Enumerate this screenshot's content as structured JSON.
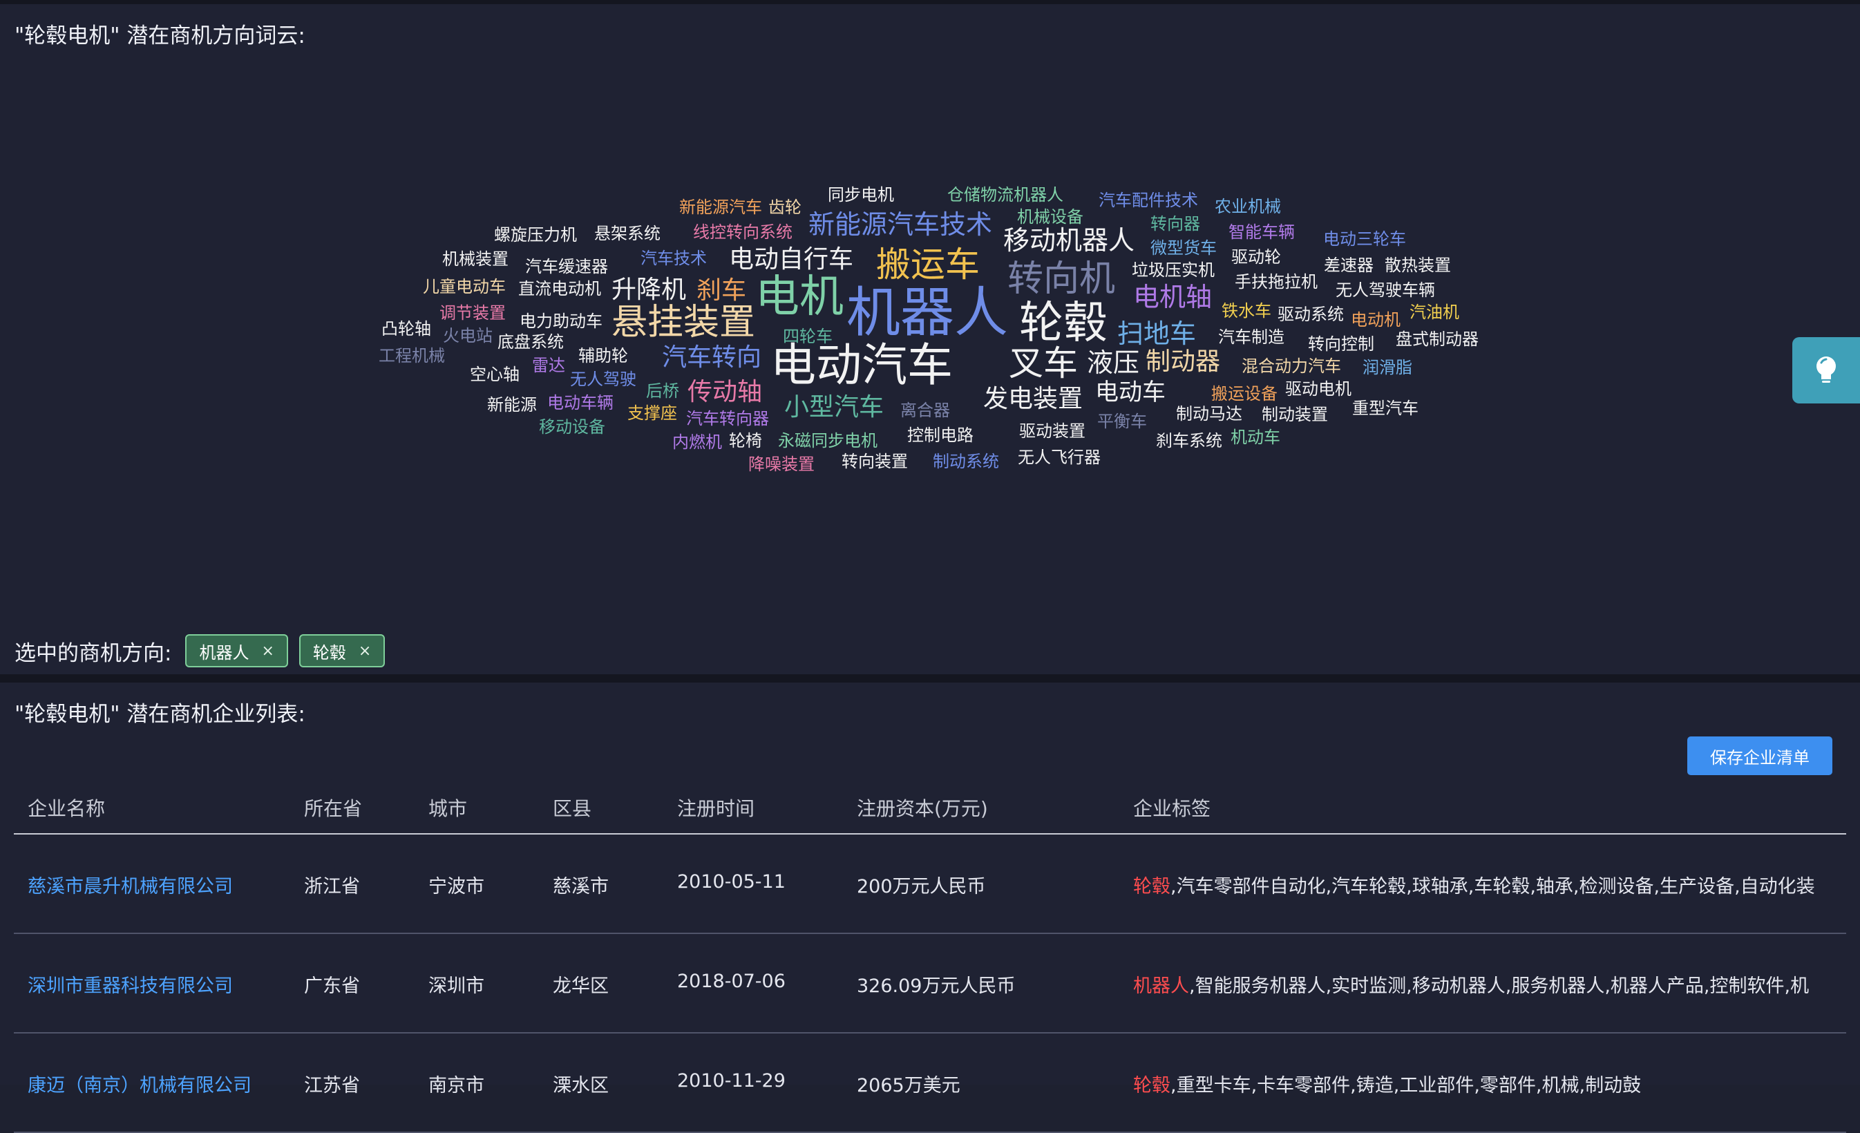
{
  "wordcloud_section": {
    "title": "\"轮毂电机\" 潜在商机方向词云:",
    "selected_label": "选中的商机方向:",
    "selected_tags": [
      "机器人",
      "轮毂"
    ],
    "tag_close": "×"
  },
  "colors": {
    "background": "#1f2233",
    "link": "#4da3ff",
    "highlight": "#ff4d4f",
    "tag_bg": "#356a4f",
    "button": "#3d8ff0"
  },
  "words": [
    {
      "t": "机器人",
      "c": "#6f8de8"
    },
    {
      "t": "电机",
      "c": "#7fd1a8"
    },
    {
      "t": "电动汽车",
      "c": "#f2f2f2"
    },
    {
      "t": "轮毂",
      "c": "#f2f2f2"
    },
    {
      "t": "悬挂装置",
      "c": "#f2d7a8"
    },
    {
      "t": "搬运车",
      "c": "#f2c24f"
    },
    {
      "t": "转向机",
      "c": "#7a82a8"
    },
    {
      "t": "叉车",
      "c": "#f2f2f2"
    },
    {
      "t": "移动机器人",
      "c": "#f2f2f2"
    },
    {
      "t": "新能源汽车技术",
      "c": "#6f8de8"
    },
    {
      "t": "电动自行车",
      "c": "#f2f2f2"
    },
    {
      "t": "升降机",
      "c": "#f2f2f2"
    },
    {
      "t": "刹车",
      "c": "#f2a25a"
    },
    {
      "t": "汽车转向",
      "c": "#6f8de8"
    },
    {
      "t": "传动轴",
      "c": "#e87aa8"
    },
    {
      "t": "小型汽车",
      "c": "#5fb8a0"
    },
    {
      "t": "液压",
      "c": "#f2f2f2"
    },
    {
      "t": "制动器",
      "c": "#f2d7a8"
    },
    {
      "t": "发电装置",
      "c": "#f2f2f2"
    },
    {
      "t": "电动车",
      "c": "#f2f2f2"
    },
    {
      "t": "电机轴",
      "c": "#b07ae8"
    },
    {
      "t": "扫地车",
      "c": "#6fb0e8"
    },
    {
      "t": "新能源汽车",
      "c": "#f2a25a"
    },
    {
      "t": "齿轮",
      "c": "#f2d7a8"
    },
    {
      "t": "同步电机",
      "c": "#f2f2f2"
    },
    {
      "t": "仓储物流机器人",
      "c": "#7fd1a8"
    },
    {
      "t": "汽车配件技术",
      "c": "#6f8de8"
    },
    {
      "t": "农业机械",
      "c": "#6fb0e8"
    },
    {
      "t": "螺旋压力机",
      "c": "#f2f2f2"
    },
    {
      "t": "悬架系统",
      "c": "#f2f2f2"
    },
    {
      "t": "线控转向系统",
      "c": "#e87aa8"
    },
    {
      "t": "机械设备",
      "c": "#7fd1a8"
    },
    {
      "t": "转向器",
      "c": "#5fb8a0"
    },
    {
      "t": "智能车辆",
      "c": "#b07ae8"
    },
    {
      "t": "电动三轮车",
      "c": "#6f8de8"
    },
    {
      "t": "机械装置",
      "c": "#f2f2f2"
    },
    {
      "t": "汽车缓速器",
      "c": "#f2f2f2"
    },
    {
      "t": "汽车技术",
      "c": "#6f8de8"
    },
    {
      "t": "微型货车",
      "c": "#6fb0e8"
    },
    {
      "t": "驱动轮",
      "c": "#f2f2f2"
    },
    {
      "t": "差速器",
      "c": "#f2f2f2"
    },
    {
      "t": "散热装置",
      "c": "#f2f2f2"
    },
    {
      "t": "儿童电动车",
      "c": "#f2d7a8"
    },
    {
      "t": "直流电动机",
      "c": "#f2f2f2"
    },
    {
      "t": "垃圾压实机",
      "c": "#f2f2f2"
    },
    {
      "t": "手扶拖拉机",
      "c": "#f2f2f2"
    },
    {
      "t": "无人驾驶车辆",
      "c": "#f2f2f2"
    },
    {
      "t": "调节装置",
      "c": "#e87aa8"
    },
    {
      "t": "电力助动车",
      "c": "#f2f2f2"
    },
    {
      "t": "铁水车",
      "c": "#f2d04f"
    },
    {
      "t": "驱动系统",
      "c": "#f2f2f2"
    },
    {
      "t": "电动机",
      "c": "#f2a25a"
    },
    {
      "t": "汽油机",
      "c": "#f2d04f"
    },
    {
      "t": "凸轮轴",
      "c": "#f2f2f2"
    },
    {
      "t": "火电站",
      "c": "#7a82a8"
    },
    {
      "t": "底盘系统",
      "c": "#f2f2f2"
    },
    {
      "t": "四轮车",
      "c": "#5fb8a0"
    },
    {
      "t": "汽车制造",
      "c": "#f2f2f2"
    },
    {
      "t": "转向控制",
      "c": "#f2f2f2"
    },
    {
      "t": "盘式制动器",
      "c": "#f2f2f2"
    },
    {
      "t": "工程机械",
      "c": "#7a82a8"
    },
    {
      "t": "辅助轮",
      "c": "#f2f2f2"
    },
    {
      "t": "雷达",
      "c": "#b07ae8"
    },
    {
      "t": "混合动力汽车",
      "c": "#f2d7a8"
    },
    {
      "t": "润滑脂",
      "c": "#6fb0e8"
    },
    {
      "t": "空心轴",
      "c": "#f2f2f2"
    },
    {
      "t": "无人驾驶",
      "c": "#6f8de8"
    },
    {
      "t": "后桥",
      "c": "#5fb8a0"
    },
    {
      "t": "驱动电机",
      "c": "#f2f2f2"
    },
    {
      "t": "搬运设备",
      "c": "#f2a25a"
    },
    {
      "t": "新能源",
      "c": "#f2f2f2"
    },
    {
      "t": "电动车辆",
      "c": "#b07ae8"
    },
    {
      "t": "离合器",
      "c": "#7a82a8"
    },
    {
      "t": "制动马达",
      "c": "#f2f2f2"
    },
    {
      "t": "制动装置",
      "c": "#f2f2f2"
    },
    {
      "t": "重型汽车",
      "c": "#f2f2f2"
    },
    {
      "t": "支撑座",
      "c": "#f2c24f"
    },
    {
      "t": "汽车转向器",
      "c": "#b07ae8"
    },
    {
      "t": "平衡车",
      "c": "#7a82a8"
    },
    {
      "t": "移动设备",
      "c": "#5fb8a0"
    },
    {
      "t": "控制电路",
      "c": "#f2f2f2"
    },
    {
      "t": "驱动装置",
      "c": "#f2f2f2"
    },
    {
      "t": "内燃机",
      "c": "#b07ae8"
    },
    {
      "t": "轮椅",
      "c": "#f2f2f2"
    },
    {
      "t": "永磁同步电机",
      "c": "#7fd1a8"
    },
    {
      "t": "刹车系统",
      "c": "#f2f2f2"
    },
    {
      "t": "机动车",
      "c": "#7fd1a8"
    },
    {
      "t": "降噪装置",
      "c": "#e87aa8"
    },
    {
      "t": "转向装置",
      "c": "#f2f2f2"
    },
    {
      "t": "制动系统",
      "c": "#6f8de8"
    },
    {
      "t": "无人飞行器",
      "c": "#f2f2f2"
    }
  ],
  "company_section": {
    "title": "\"轮毂电机\" 潜在商机企业列表:",
    "save_button": "保存企业清单",
    "columns": [
      "企业名称",
      "所在省",
      "城市",
      "区县",
      "注册时间",
      "注册资本(万元)",
      "企业标签"
    ],
    "rows": [
      {
        "name": "慈溪市晨升机械有限公司",
        "province": "浙江省",
        "city": "宁波市",
        "district": "慈溪市",
        "date": "2010-05-11",
        "capital": "200万元人民币",
        "tag_highlight": "轮毂",
        "tags": ",汽车零部件自动化,汽车轮毂,球轴承,车轮毂,轴承,检测设备,生产设备,自动化装"
      },
      {
        "name": "深圳市重器科技有限公司",
        "province": "广东省",
        "city": "深圳市",
        "district": "龙华区",
        "date": "2018-07-06",
        "capital": "326.09万元人民币",
        "tag_highlight": "机器人",
        "tags": ",智能服务机器人,实时监测,移动机器人,服务机器人,机器人产品,控制软件,机"
      },
      {
        "name": "康迈（南京）机械有限公司",
        "province": "江苏省",
        "city": "南京市",
        "district": "溧水区",
        "date": "2010-11-29",
        "capital": "2065万美元",
        "tag_highlight": "轮毂",
        "tags": ",重型卡车,卡车零部件,铸造,工业部件,零部件,机械,制动鼓"
      }
    ]
  }
}
